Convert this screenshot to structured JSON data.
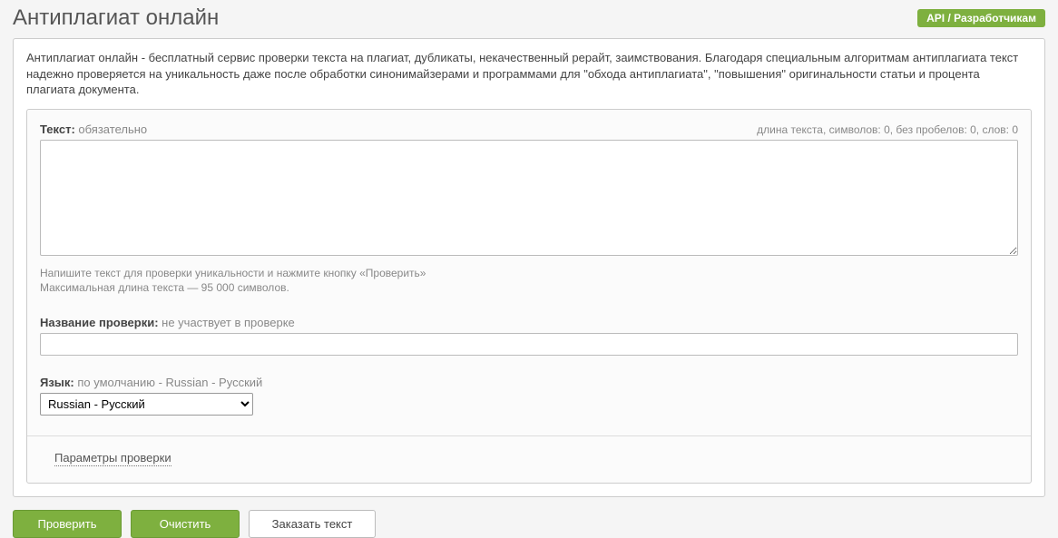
{
  "header": {
    "title": "Антиплагиат онлайн",
    "api_badge": "API / Разработчикам"
  },
  "description": "Антиплагиат онлайн - бесплатный сервис проверки текста на плагиат, дубликаты, некачественный рерайт, заимствования. Благодаря специальным алгоритмам антиплагиата текст надежно проверяется на уникальность даже после обработки синонимайзерами и программами для \"обхода антиплагиата\", \"повышения\" оригинальности статьи и процента плагиата документа.",
  "form": {
    "text_label": "Текст:",
    "text_required": "обязательно",
    "stats": "длина текста, символов: 0, без пробелов: 0, слов: 0",
    "text_value": "",
    "hint_line1": "Напишите текст для проверки уникальности и нажмите кнопку «Проверить»",
    "hint_line2": "Максимальная длина текста — 95 000 символов.",
    "title_label": "Название проверки:",
    "title_sub": "не участвует в проверке",
    "title_value": "",
    "lang_label": "Язык:",
    "lang_sub": "по умолчанию - Russian - Русский",
    "lang_value": "Russian - Русский",
    "params_link": "Параметры проверки"
  },
  "buttons": {
    "check": "Проверить",
    "clear": "Очистить",
    "order": "Заказать текст"
  }
}
